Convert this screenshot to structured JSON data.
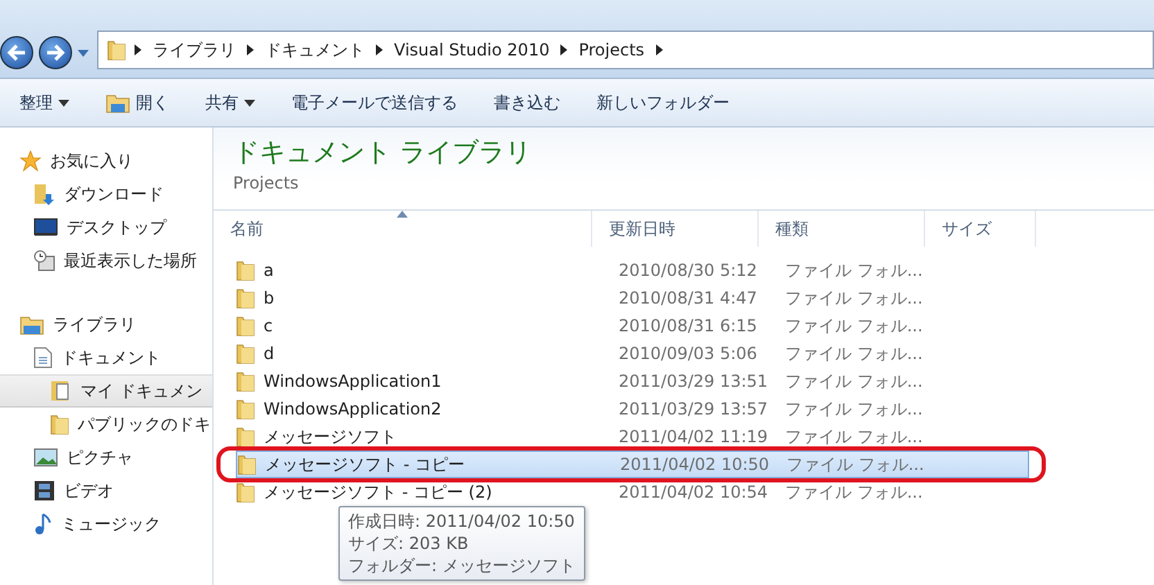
{
  "address_bar": {
    "breadcrumbs": [
      "ライブラリ",
      "ドキュメント",
      "Visual Studio 2010",
      "Projects"
    ]
  },
  "toolbar": [
    {
      "label": "整理",
      "kind": "menu"
    },
    {
      "label": "開く",
      "kind": "open"
    },
    {
      "label": "共有",
      "kind": "menu"
    },
    {
      "label": "電子メールで送信する",
      "kind": "plain"
    },
    {
      "label": "書き込む",
      "kind": "plain"
    },
    {
      "label": "新しいフォルダー",
      "kind": "plain"
    }
  ],
  "sidebar": {
    "groups": [
      {
        "title": "お気に入り",
        "kind": "star",
        "items": [
          {
            "label": "ダウンロード",
            "kind": "download",
            "selected": false
          },
          {
            "label": "デスクトップ",
            "kind": "desktop",
            "selected": false
          },
          {
            "label": "最近表示した場所",
            "kind": "recent",
            "selected": false
          }
        ]
      },
      {
        "title": "ライブラリ",
        "kind": "library",
        "items": [
          {
            "label": "ドキュメント",
            "kind": "document",
            "selected": false,
            "children": [
              {
                "label": "マイ ドキュメン",
                "kind": "docfolder",
                "selected": true
              },
              {
                "label": "パブリックのドキ",
                "kind": "folder",
                "selected": false
              }
            ]
          },
          {
            "label": "ピクチャ",
            "kind": "picture",
            "selected": false
          },
          {
            "label": "ビデオ",
            "kind": "video",
            "selected": false
          },
          {
            "label": "ミュージック",
            "kind": "music",
            "selected": false
          }
        ]
      }
    ]
  },
  "library": {
    "title": "ドキュメント ライブラリ",
    "subtitle": "Projects"
  },
  "columns": [
    {
      "label": "名前",
      "sorted": true
    },
    {
      "label": "更新日時",
      "sorted": false
    },
    {
      "label": "種類",
      "sorted": false
    },
    {
      "label": "サイズ",
      "sorted": false
    }
  ],
  "rows": [
    {
      "name": "a",
      "modified": "2010/08/30 5:12",
      "type": "ファイル フォル...",
      "selected": false,
      "circled": false
    },
    {
      "name": "b",
      "modified": "2010/08/31 4:47",
      "type": "ファイル フォル...",
      "selected": false,
      "circled": false
    },
    {
      "name": "c",
      "modified": "2010/08/31 6:15",
      "type": "ファイル フォル...",
      "selected": false,
      "circled": false
    },
    {
      "name": "d",
      "modified": "2010/09/03 5:06",
      "type": "ファイル フォル...",
      "selected": false,
      "circled": false
    },
    {
      "name": "WindowsApplication1",
      "modified": "2011/03/29 13:51",
      "type": "ファイル フォル...",
      "selected": false,
      "circled": false
    },
    {
      "name": "WindowsApplication2",
      "modified": "2011/03/29 13:57",
      "type": "ファイル フォル...",
      "selected": false,
      "circled": false
    },
    {
      "name": "メッセージソフト",
      "modified": "2011/04/02 11:19",
      "type": "ファイル フォル...",
      "selected": false,
      "circled": false
    },
    {
      "name": "メッセージソフト - コピー",
      "modified": "2011/04/02 10:50",
      "type": "ファイル フォル...",
      "selected": true,
      "circled": true
    },
    {
      "name": "メッセージソフト - コピー (2)",
      "modified": "2011/04/02 10:54",
      "type": "ファイル フォル...",
      "selected": false,
      "circled": false
    }
  ],
  "tooltip": {
    "lines": [
      "作成日時: 2011/04/02 10:50",
      "サイズ: 203 KB",
      "フォルダー: メッセージソフト"
    ]
  }
}
